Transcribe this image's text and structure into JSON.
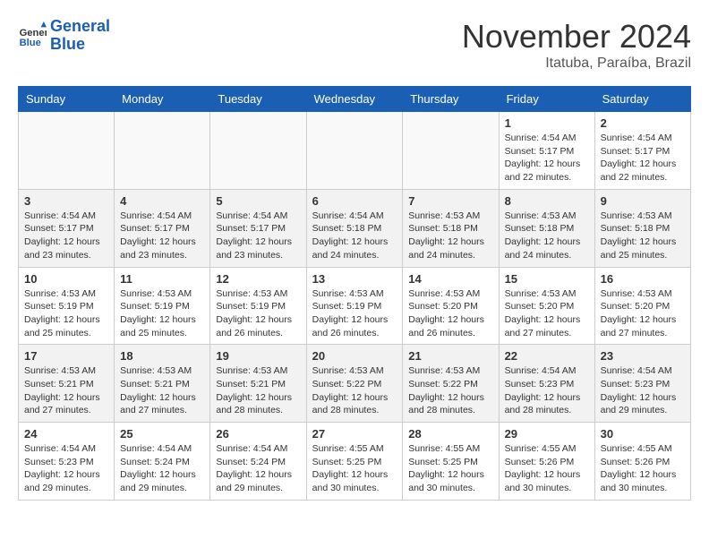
{
  "header": {
    "logo_line1": "General",
    "logo_line2": "Blue",
    "month": "November 2024",
    "location": "Itatuba, Paraíba, Brazil"
  },
  "weekdays": [
    "Sunday",
    "Monday",
    "Tuesday",
    "Wednesday",
    "Thursday",
    "Friday",
    "Saturday"
  ],
  "weeks": [
    [
      {
        "day": "",
        "info": ""
      },
      {
        "day": "",
        "info": ""
      },
      {
        "day": "",
        "info": ""
      },
      {
        "day": "",
        "info": ""
      },
      {
        "day": "",
        "info": ""
      },
      {
        "day": "1",
        "info": "Sunrise: 4:54 AM\nSunset: 5:17 PM\nDaylight: 12 hours\nand 22 minutes."
      },
      {
        "day": "2",
        "info": "Sunrise: 4:54 AM\nSunset: 5:17 PM\nDaylight: 12 hours\nand 22 minutes."
      }
    ],
    [
      {
        "day": "3",
        "info": "Sunrise: 4:54 AM\nSunset: 5:17 PM\nDaylight: 12 hours\nand 23 minutes."
      },
      {
        "day": "4",
        "info": "Sunrise: 4:54 AM\nSunset: 5:17 PM\nDaylight: 12 hours\nand 23 minutes."
      },
      {
        "day": "5",
        "info": "Sunrise: 4:54 AM\nSunset: 5:17 PM\nDaylight: 12 hours\nand 23 minutes."
      },
      {
        "day": "6",
        "info": "Sunrise: 4:54 AM\nSunset: 5:18 PM\nDaylight: 12 hours\nand 24 minutes."
      },
      {
        "day": "7",
        "info": "Sunrise: 4:53 AM\nSunset: 5:18 PM\nDaylight: 12 hours\nand 24 minutes."
      },
      {
        "day": "8",
        "info": "Sunrise: 4:53 AM\nSunset: 5:18 PM\nDaylight: 12 hours\nand 24 minutes."
      },
      {
        "day": "9",
        "info": "Sunrise: 4:53 AM\nSunset: 5:18 PM\nDaylight: 12 hours\nand 25 minutes."
      }
    ],
    [
      {
        "day": "10",
        "info": "Sunrise: 4:53 AM\nSunset: 5:19 PM\nDaylight: 12 hours\nand 25 minutes."
      },
      {
        "day": "11",
        "info": "Sunrise: 4:53 AM\nSunset: 5:19 PM\nDaylight: 12 hours\nand 25 minutes."
      },
      {
        "day": "12",
        "info": "Sunrise: 4:53 AM\nSunset: 5:19 PM\nDaylight: 12 hours\nand 26 minutes."
      },
      {
        "day": "13",
        "info": "Sunrise: 4:53 AM\nSunset: 5:19 PM\nDaylight: 12 hours\nand 26 minutes."
      },
      {
        "day": "14",
        "info": "Sunrise: 4:53 AM\nSunset: 5:20 PM\nDaylight: 12 hours\nand 26 minutes."
      },
      {
        "day": "15",
        "info": "Sunrise: 4:53 AM\nSunset: 5:20 PM\nDaylight: 12 hours\nand 27 minutes."
      },
      {
        "day": "16",
        "info": "Sunrise: 4:53 AM\nSunset: 5:20 PM\nDaylight: 12 hours\nand 27 minutes."
      }
    ],
    [
      {
        "day": "17",
        "info": "Sunrise: 4:53 AM\nSunset: 5:21 PM\nDaylight: 12 hours\nand 27 minutes."
      },
      {
        "day": "18",
        "info": "Sunrise: 4:53 AM\nSunset: 5:21 PM\nDaylight: 12 hours\nand 27 minutes."
      },
      {
        "day": "19",
        "info": "Sunrise: 4:53 AM\nSunset: 5:21 PM\nDaylight: 12 hours\nand 28 minutes."
      },
      {
        "day": "20",
        "info": "Sunrise: 4:53 AM\nSunset: 5:22 PM\nDaylight: 12 hours\nand 28 minutes."
      },
      {
        "day": "21",
        "info": "Sunrise: 4:53 AM\nSunset: 5:22 PM\nDaylight: 12 hours\nand 28 minutes."
      },
      {
        "day": "22",
        "info": "Sunrise: 4:54 AM\nSunset: 5:23 PM\nDaylight: 12 hours\nand 28 minutes."
      },
      {
        "day": "23",
        "info": "Sunrise: 4:54 AM\nSunset: 5:23 PM\nDaylight: 12 hours\nand 29 minutes."
      }
    ],
    [
      {
        "day": "24",
        "info": "Sunrise: 4:54 AM\nSunset: 5:23 PM\nDaylight: 12 hours\nand 29 minutes."
      },
      {
        "day": "25",
        "info": "Sunrise: 4:54 AM\nSunset: 5:24 PM\nDaylight: 12 hours\nand 29 minutes."
      },
      {
        "day": "26",
        "info": "Sunrise: 4:54 AM\nSunset: 5:24 PM\nDaylight: 12 hours\nand 29 minutes."
      },
      {
        "day": "27",
        "info": "Sunrise: 4:55 AM\nSunset: 5:25 PM\nDaylight: 12 hours\nand 30 minutes."
      },
      {
        "day": "28",
        "info": "Sunrise: 4:55 AM\nSunset: 5:25 PM\nDaylight: 12 hours\nand 30 minutes."
      },
      {
        "day": "29",
        "info": "Sunrise: 4:55 AM\nSunset: 5:26 PM\nDaylight: 12 hours\nand 30 minutes."
      },
      {
        "day": "30",
        "info": "Sunrise: 4:55 AM\nSunset: 5:26 PM\nDaylight: 12 hours\nand 30 minutes."
      }
    ]
  ]
}
